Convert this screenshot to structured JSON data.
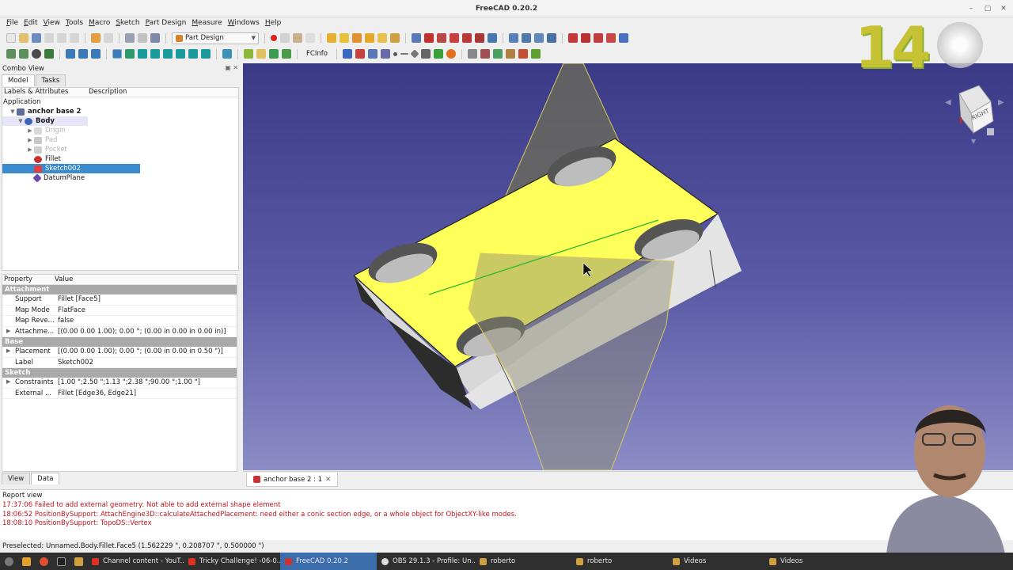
{
  "window": {
    "title": "FreeCAD 0.20.2",
    "controls": [
      "–",
      "▢",
      "✕"
    ]
  },
  "menu": [
    "File",
    "Edit",
    "View",
    "Tools",
    "Macro",
    "Sketch",
    "Part Design",
    "Measure",
    "Windows",
    "Help"
  ],
  "toolbar": {
    "workbench": "Part Design",
    "fcinfo": "FCInfo"
  },
  "combo": {
    "title": "Combo View",
    "tabs": [
      "Model",
      "Tasks"
    ],
    "tree_headers": [
      "Labels & Attributes",
      "Description"
    ],
    "tree": {
      "application": "Application",
      "document": "anchor base 2",
      "body": "Body",
      "items": [
        "Origin",
        "Pad",
        "Pocket",
        "Fillet",
        "Sketch002",
        "DatumPlane"
      ]
    },
    "props_headers": [
      "Property",
      "Value"
    ],
    "groups": [
      {
        "name": "Attachment",
        "rows": [
          {
            "name": "Support",
            "value": "Fillet [Face5]"
          },
          {
            "name": "Map Mode",
            "value": "FlatFace"
          },
          {
            "name": "Map Reve...",
            "value": "false"
          },
          {
            "name": "Attachme...",
            "value": "[(0.00 0.00 1.00); 0.00 °; (0.00 in  0.00 in  0.00 in)]"
          }
        ]
      },
      {
        "name": "Base",
        "rows": [
          {
            "name": "Placement",
            "value": "[(0.00 0.00 1.00); 0.00 °; (0.00 in  0.00 in  0.50 \")]"
          },
          {
            "name": "Label",
            "value": "Sketch002"
          }
        ]
      },
      {
        "name": "Sketch",
        "rows": [
          {
            "name": "Constraints",
            "value": "[1.00 \";2.50 \";1.13 \";2.38 \";90.00 °;1.00 \"]"
          },
          {
            "name": "External ...",
            "value": "Fillet [Edge36, Edge21]"
          }
        ]
      }
    ],
    "bottom_tabs": [
      "View",
      "Data"
    ]
  },
  "document_tab": {
    "label": "anchor base 2 : 1",
    "close": "✕"
  },
  "navcube": {
    "face": "RIGHT"
  },
  "logo_text": "14",
  "report": {
    "title": "Report view",
    "lines": [
      "17:37:06  Failed to add external geometry: Not able to add external shape element",
      "18:06:52  PositionBySupport: AttachEngine3D::calculateAttachedPlacement: need either a conic section edge, or a whole object for ObjectXY-like modes.",
      "18:08:10  PositionBySupport: TopoDS::Vertex"
    ]
  },
  "status": "Preselected: Unnamed.Body.Fillet.Face5 (1.562229 \", 0.208707 \", 0.500000 \")",
  "taskbar": {
    "windows": [
      "Channel content - YouT...",
      "Tricky Challenge! -06-0...",
      "FreeCAD 0.20.2",
      "OBS 29.1.3 - Profile: Un...",
      "roberto",
      "roberto",
      "Videos",
      "Videos"
    ]
  },
  "colors": {
    "selection": "#3a8cce",
    "face_highlight": "#ffff5a",
    "error": "#c4141e",
    "viewport_top": "#3a3a86",
    "viewport_bottom": "#8c8cc6"
  }
}
